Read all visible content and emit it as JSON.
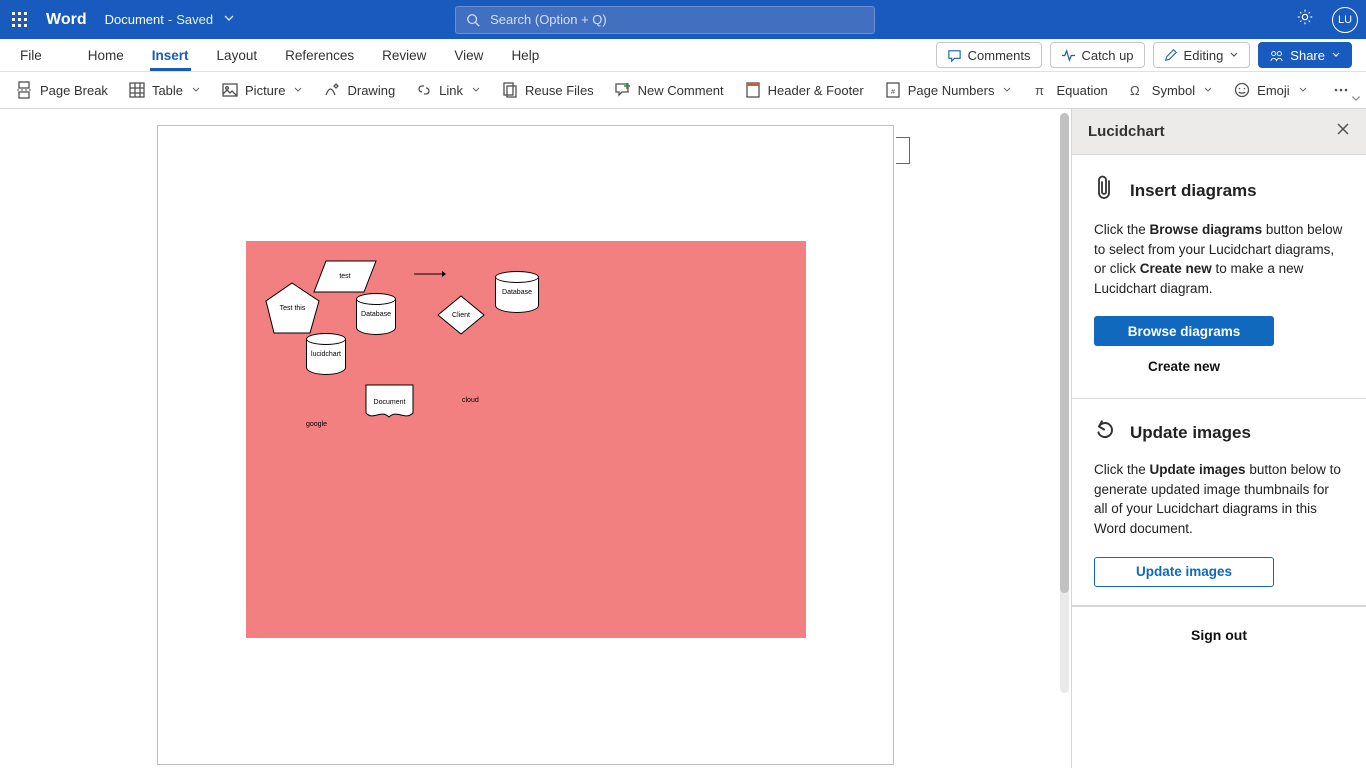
{
  "titlebar": {
    "app_name": "Word",
    "doc_name": "Document",
    "status_sep": " - ",
    "status": "Saved",
    "search_placeholder": "Search (Option + Q)",
    "avatar_initials": "LU"
  },
  "tabs": {
    "file": "File",
    "home": "Home",
    "insert": "Insert",
    "layout": "Layout",
    "references": "References",
    "review": "Review",
    "view": "View",
    "help": "Help"
  },
  "tabs_right": {
    "comments": "Comments",
    "catch_up": "Catch up",
    "editing": "Editing",
    "share": "Share"
  },
  "toolbar": {
    "page_break": "Page Break",
    "table": "Table",
    "picture": "Picture",
    "drawing": "Drawing",
    "link": "Link",
    "reuse_files": "Reuse Files",
    "new_comment": "New Comment",
    "header_footer": "Header & Footer",
    "page_numbers": "Page Numbers",
    "equation": "Equation",
    "symbol": "Symbol",
    "emoji": "Emoji"
  },
  "diagram": {
    "pentagon": "Test this",
    "parallelogram": "test",
    "cyl1": "Database",
    "cyl2": "Database",
    "cyl3": "lucidchart",
    "diamond": "Client",
    "document": "Document",
    "google": "google",
    "cloud": "cloud"
  },
  "panel": {
    "title": "Lucidchart",
    "section1": {
      "title": "Insert diagrams",
      "text_pre": "Click the ",
      "text_b1": "Browse diagrams",
      "text_mid": " button below to select from your Lucidchart diagrams, or click ",
      "text_b2": "Create new",
      "text_post": " to make a new Lucidchart diagram.",
      "btn_browse": "Browse diagrams",
      "btn_create": "Create new"
    },
    "section2": {
      "title": "Update images",
      "text_pre": "Click the ",
      "text_b1": "Update images",
      "text_post": " button below to generate updated image thumbnails for all of your Lucidchart diagrams in this Word document.",
      "btn_update": "Update images"
    },
    "sign_out": "Sign out"
  }
}
